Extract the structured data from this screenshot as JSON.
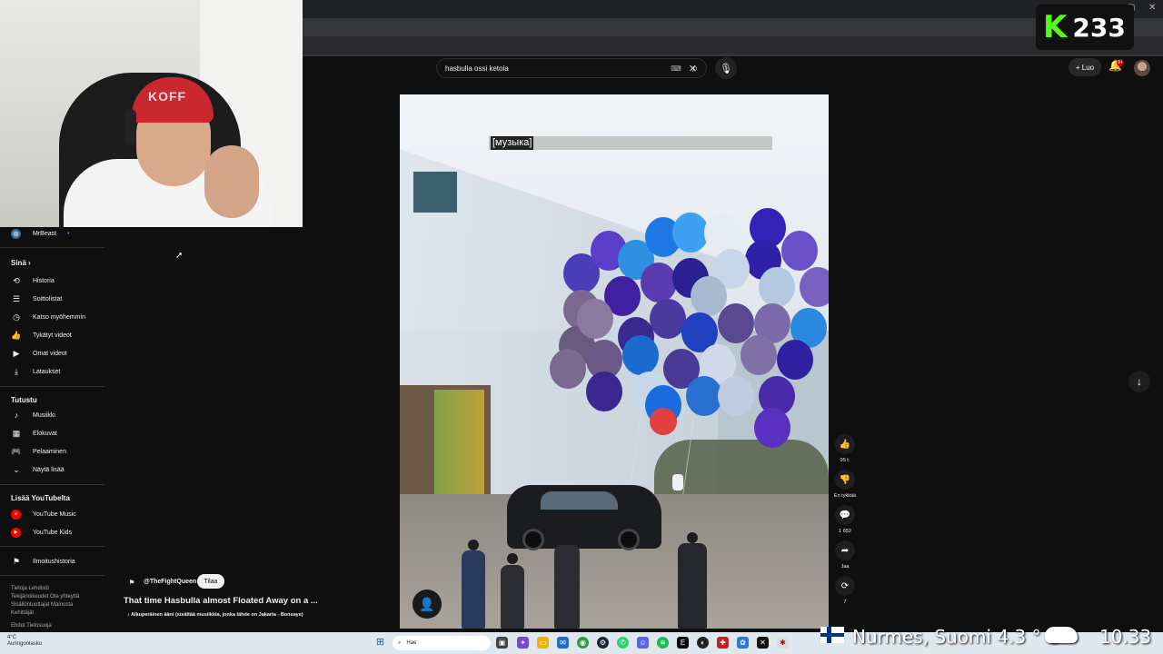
{
  "browser": {
    "window_controls": [
      "–",
      "▢",
      "✕"
    ]
  },
  "webcam": {
    "cap_text": "KOFF"
  },
  "kick": {
    "logo": "K",
    "count": "233"
  },
  "header": {
    "search_value": "hasbulla ossi ketola",
    "create_label": "Luo",
    "notification_count": "9+"
  },
  "sidebar": {
    "subscription": {
      "label": "MrBeast",
      "dot": "•"
    },
    "you_heading": "Sinä",
    "you_items": [
      {
        "label": "Historia",
        "icon": "history-icon"
      },
      {
        "label": "Soittolistat",
        "icon": "playlists-icon"
      },
      {
        "label": "Katso myöhemmin",
        "icon": "watch-later-icon"
      },
      {
        "label": "Tykätyt videot",
        "icon": "liked-icon"
      },
      {
        "label": "Omat videot",
        "icon": "my-videos-icon"
      },
      {
        "label": "Lataukset",
        "icon": "downloads-icon"
      }
    ],
    "explore_heading": "Tutustu",
    "explore_items": [
      {
        "label": "Musiikki",
        "icon": "music-icon"
      },
      {
        "label": "Elokuvat",
        "icon": "movies-icon"
      },
      {
        "label": "Pelaaminen",
        "icon": "gaming-icon"
      },
      {
        "label": "Näytä lisää",
        "icon": "chevron-down-icon"
      }
    ],
    "more_heading": "Lisää YouTubelta",
    "more_items": [
      {
        "label": "YouTube Music"
      },
      {
        "label": "YouTube Kids"
      }
    ],
    "report_history": "Ilmoitushistoria",
    "footer_lines": [
      "Tietoja  Lehdistö",
      "Tekijänoikeudet  Ota yhteyttä",
      "Sisällöntuottajat  Mainosta",
      "Kehittäjät"
    ],
    "footer_bottom": "Ehdot  Tietosuoja"
  },
  "video": {
    "subtitle": "[музыка]",
    "channel": "@TheFightQueen",
    "subscribe_label": "Tilaa",
    "title": "That time Hasbulla almost Floated Away on a ...",
    "audio": "♪ Alkuperäinen ääni (sisältää musiikkia, jonka lähde on Jakarta - Bonsaye)"
  },
  "actions": [
    {
      "name": "like",
      "icon": "👍",
      "label": "95 t."
    },
    {
      "name": "dislike",
      "icon": "👎",
      "label": "En tykkää"
    },
    {
      "name": "comments",
      "icon": "💬",
      "label": "1 652"
    },
    {
      "name": "share",
      "icon": "➦",
      "label": "Jaa"
    },
    {
      "name": "remix",
      "icon": "⟳",
      "label": "7"
    }
  ],
  "taskbar": {
    "weather_temp": "4°C",
    "weather_desc": "Auringonlasku",
    "search_placeholder": "Hae"
  },
  "overlay": {
    "location": "Nurmes, Suomi   4.3 ° C",
    "time": "10.33"
  },
  "colors": {
    "background": "#0f0f0f",
    "kick_green": "#53fc18",
    "yt_red": "#ff0000"
  }
}
